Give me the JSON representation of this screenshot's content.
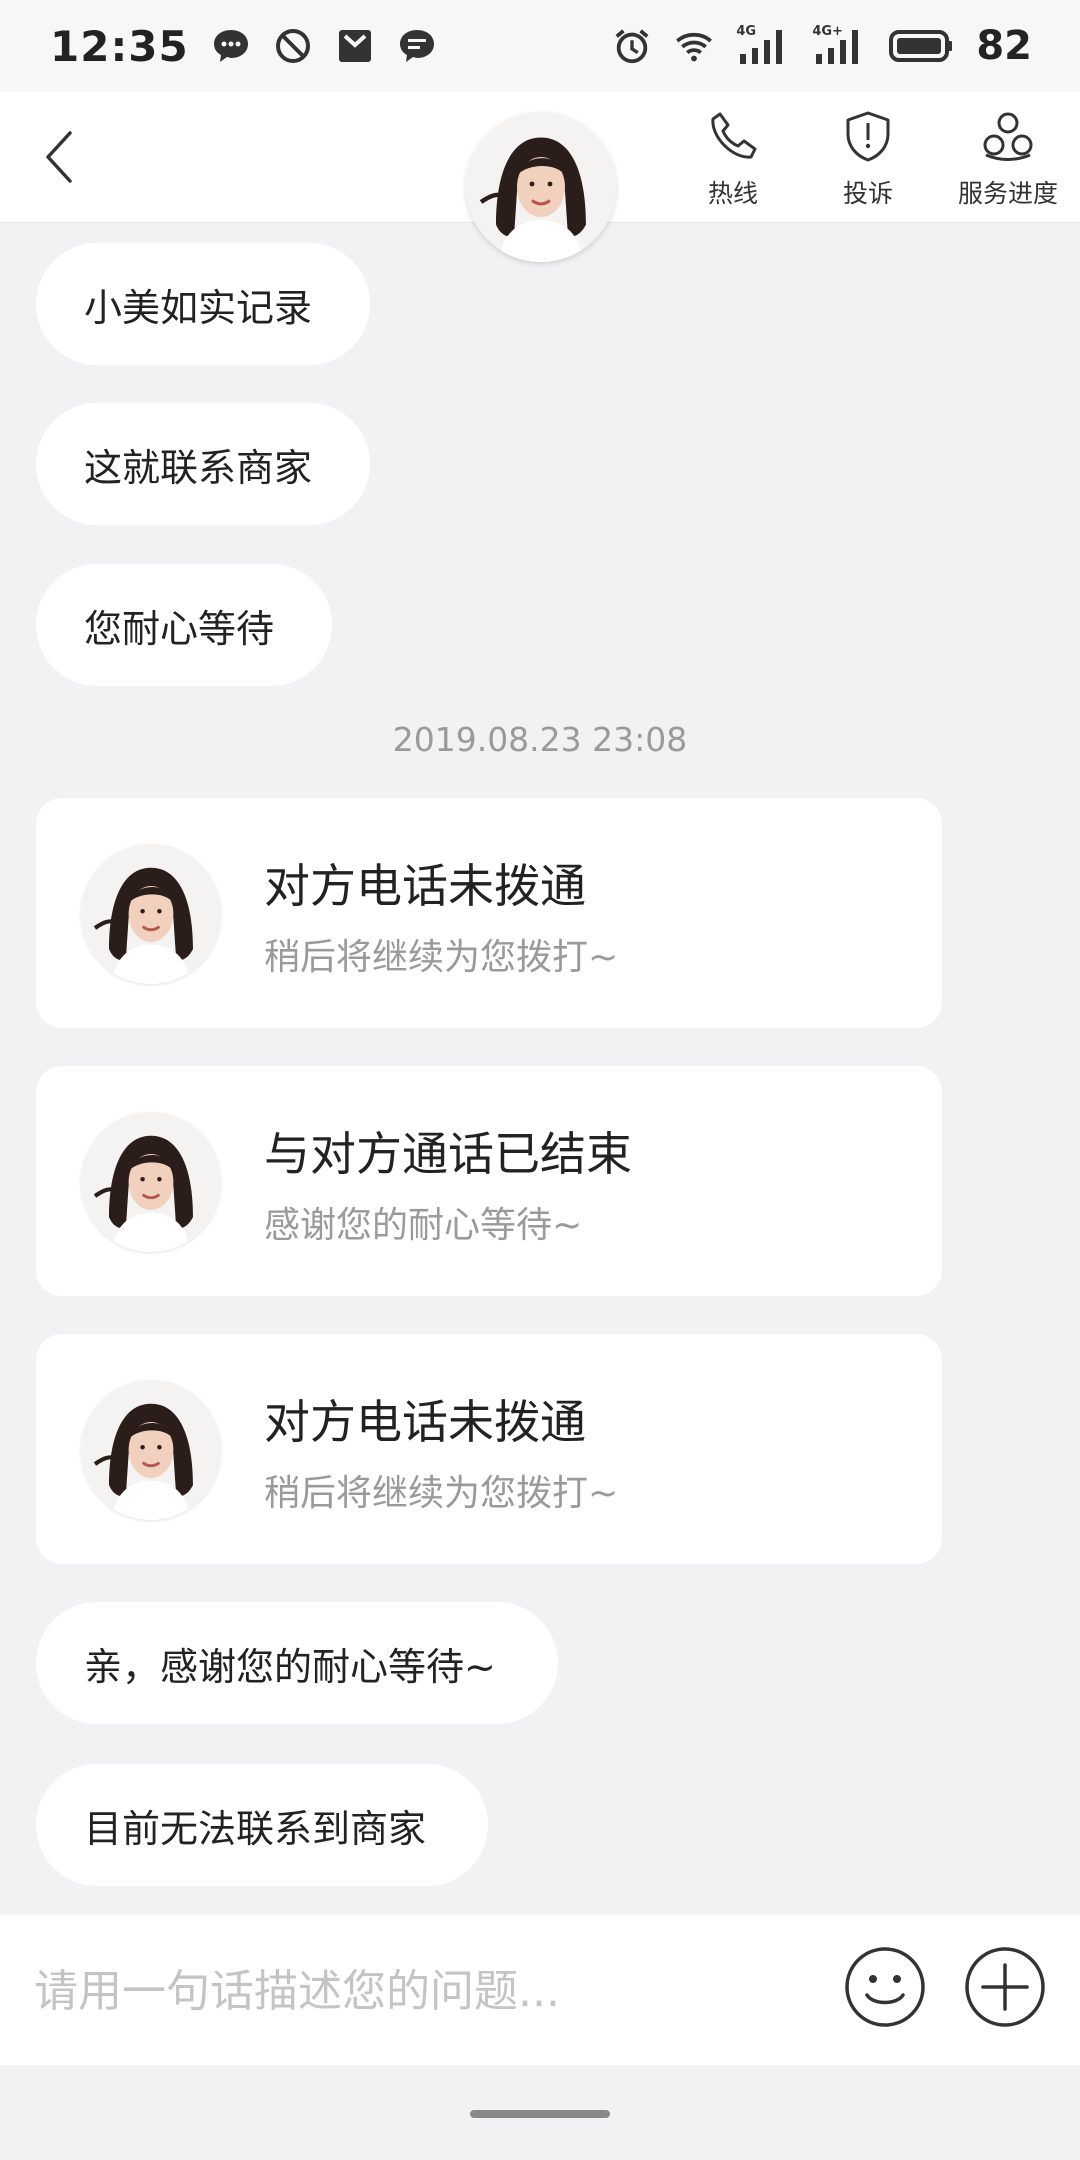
{
  "status_bar": {
    "time": "12:35",
    "battery": "82",
    "network_label_1": "4G",
    "network_label_2": "4G+",
    "icons": [
      "chat-bubble-icon",
      "blocked-icon",
      "mail-icon",
      "message-icon",
      "alarm-icon",
      "wifi-icon",
      "signal-icon",
      "signal-icon-2",
      "battery-icon"
    ]
  },
  "header": {
    "actions": [
      {
        "label": "热线",
        "icon": "phone-icon"
      },
      {
        "label": "投诉",
        "icon": "shield-icon"
      },
      {
        "label": "服务进度",
        "icon": "progress-icon"
      }
    ]
  },
  "messages": [
    {
      "text": "小美如实记录"
    },
    {
      "text": "这就联系商家"
    },
    {
      "text": "您耐心等待"
    }
  ],
  "timestamp": "2019.08.23 23:08",
  "cards": [
    {
      "title": "对方电话未拨通",
      "subtitle": "稍后将继续为您拨打~"
    },
    {
      "title": "与对方通话已结束",
      "subtitle": "感谢您的耐心等待~"
    },
    {
      "title": "对方电话未拨通",
      "subtitle": "稍后将继续为您拨打~"
    }
  ],
  "messages_after": [
    {
      "text": "亲，感谢您的耐心等待~"
    },
    {
      "text": "目前无法联系到商家"
    }
  ],
  "input": {
    "placeholder": "请用一句话描述您的问题...",
    "value": ""
  },
  "colors": {
    "background": "#f2f2f4",
    "bubble": "#ffffff",
    "muted_text": "#9a9a9a"
  }
}
